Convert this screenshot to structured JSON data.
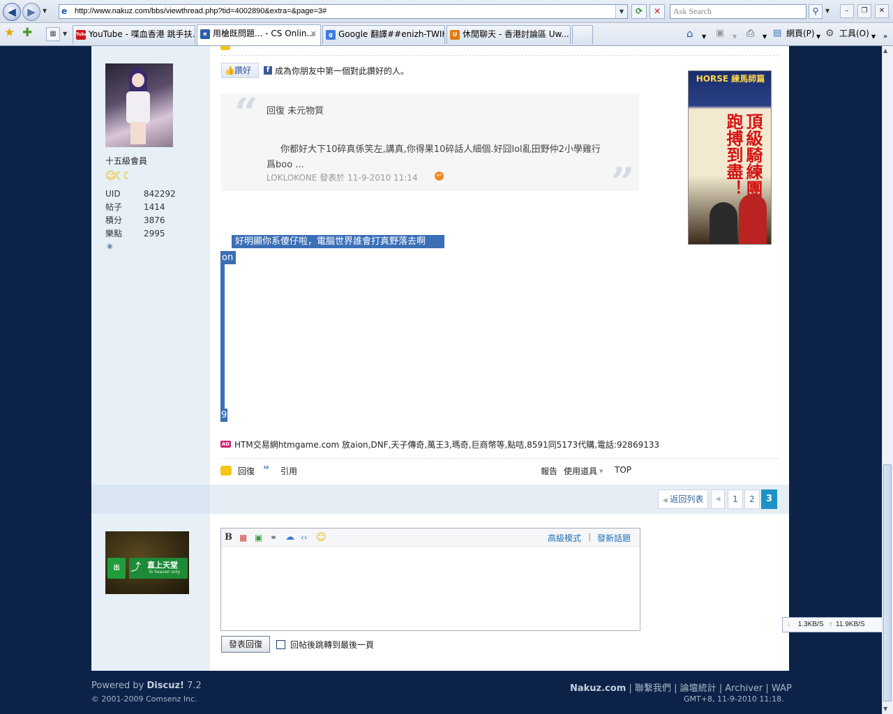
{
  "browser": {
    "url": "http://www.nakuz.com/bbs/viewthread.php?tid=4002890&extra=&page=3#",
    "search_placeholder": "Ask Search",
    "tabs": [
      {
        "label": "YouTube - 喋血香港 跳手扶...",
        "icon_color": "#cc181e",
        "icon": "Tube"
      },
      {
        "label": "用槍既問題... - CS Onlin...",
        "icon_color": "#2a5db0",
        "icon": "e"
      },
      {
        "label": "Google 翻譯##enizh-TWIHOLI",
        "icon_color": "#3b7de0",
        "icon": "g"
      },
      {
        "label": "休閒聊天 - 香港討論區 Uw...",
        "icon_color": "#e07a10",
        "icon": "U"
      }
    ],
    "cmd_page": "網頁(P)",
    "cmd_tools": "工具(O)",
    "speed_down": "1.3KB/S",
    "speed_up": "11.9KB/S"
  },
  "user": {
    "rank": "十五級會員",
    "stats": [
      {
        "label": "UID",
        "value": "842292"
      },
      {
        "label": "帖子",
        "value": "1414"
      },
      {
        "label": "積分",
        "value": "3876"
      },
      {
        "label": "樂點",
        "value": "2995"
      }
    ]
  },
  "post": {
    "like_label": "讚好",
    "like_text": "成為你朋友中第一個對此讚好的人。",
    "quote_head": "回復  未元物質",
    "quote_body": "你都好大下10碎真係笑左,講真,你得果10碎話人細個.好囧lol亂田野仲2小學雞行爲boo ...",
    "quote_author": "LOKLOKONE 發表於 11-9-2010 11:14",
    "message_line1": "好明顯你系傻仔啦，電腦世界誰會打真野落去啊",
    "message_line2": "on",
    "message_line3": "9",
    "ad_badge": "AD",
    "ad_text": "HTM交易網htmgame.com 放aion,DNF,天子傳奇,萬王3,瑪奇,巨商幣等,點咭,8591同5173代購,電話:92869133",
    "ad_banner_top": "HORSE 練馬師篇",
    "ad_banner_main": "頂級騎練團代跑搏到盡！"
  },
  "actions": {
    "reply": "回復",
    "quote": "引用",
    "report": "報告",
    "tools": "使用道具",
    "top": "TOP"
  },
  "pager": {
    "back": "返回列表",
    "pages": [
      "1",
      "2",
      "3"
    ],
    "current": "3"
  },
  "editor": {
    "advanced": "高級模式",
    "new_topic": "發新話題",
    "submit": "發表回復",
    "jump_label": "回帖後跳轉到最後一頁",
    "jump_checked": false,
    "bold_label": "B",
    "avatar_sign_text": "直上天堂",
    "avatar_sign_sub": "To heaven only"
  },
  "footer": {
    "powered_prefix": "Powered by",
    "powered_name": "Discuz!",
    "powered_version": "7.2",
    "copyright": "© 2001-2009 Comsenz Inc.",
    "links": [
      "Nakuz.com",
      "聯繫我們",
      "論壇統計",
      "Archiver",
      "WAP"
    ],
    "time": "GMT+8, 11-9-2010 11:18."
  }
}
